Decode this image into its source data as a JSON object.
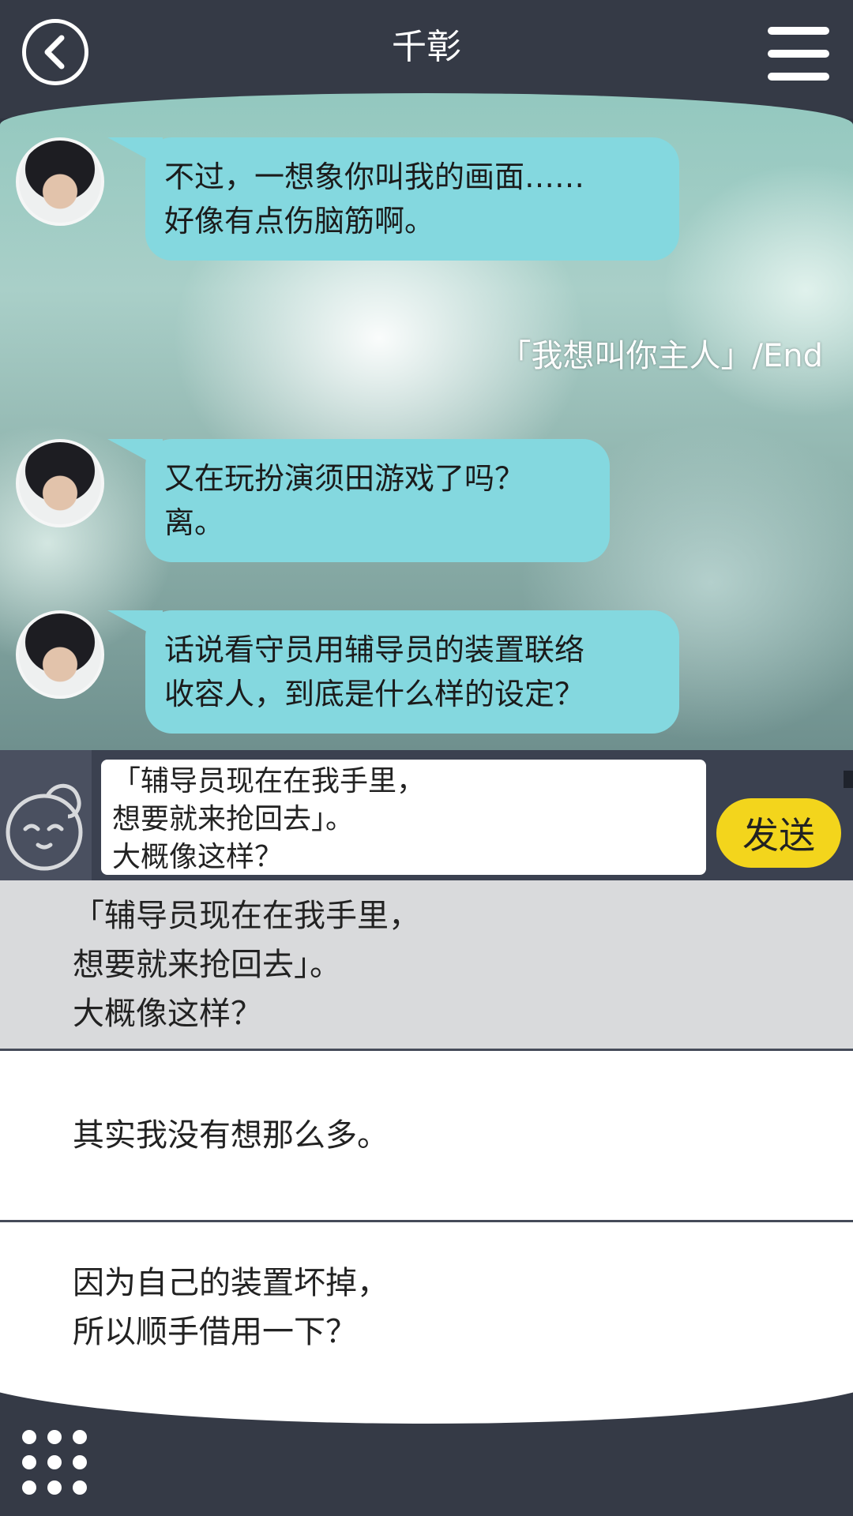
{
  "header": {
    "title": "千彰"
  },
  "chat": {
    "messages": [
      {
        "text": "不过，一想象你叫我的画面……\n好像有点伤脑筋啊。"
      },
      {
        "text": "又在玩扮演须田游戏了吗？\n离。"
      },
      {
        "text": "话说看守员用辅导员的装置联络\n收容人，到底是什么样的设定？"
      }
    ],
    "system_note": "「我想叫你主人」/End"
  },
  "input": {
    "value": "「辅导员现在在我手里，\n想要就来抢回去」。\n大概像这样？",
    "send_label": "发送"
  },
  "options": [
    "「辅导员现在在我手里，\n想要就来抢回去」。\n大概像这样？",
    "其实我没有想那么多。",
    "因为自己的装置坏掉，\n所以顺手借用一下？"
  ],
  "colors": {
    "header_bg": "#353a46",
    "bubble": "#84d8df",
    "send_button": "#f3d51c",
    "selected_option": "#d9dadc"
  },
  "icons": {
    "back": "back-arrow-icon",
    "menu": "hamburger-menu-icon",
    "sticker": "face-sticker-icon",
    "grid": "grid-menu-icon"
  }
}
